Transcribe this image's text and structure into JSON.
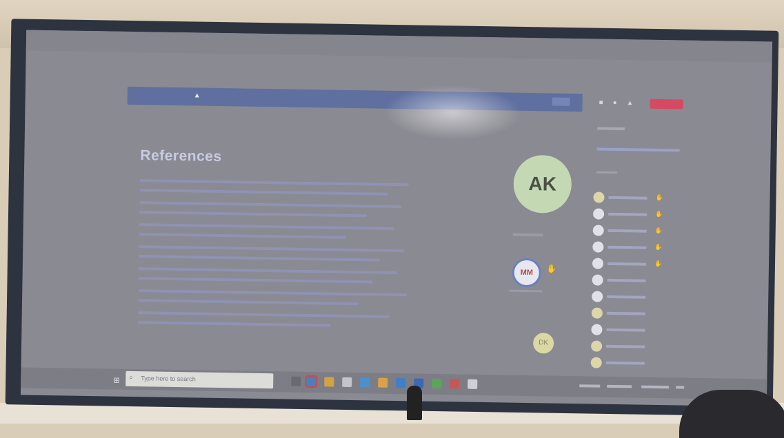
{
  "meeting": {
    "title_bar": "",
    "recording_banner": {
      "label": "",
      "message": "",
      "dismiss_label": ""
    }
  },
  "shared_content": {
    "heading": "References"
  },
  "stage": {
    "presenter_initials": "AK",
    "participant_initials_1": "MM",
    "participant_initials_2": "DK"
  },
  "participants_panel": {
    "heading": "",
    "rows": 11,
    "raised_hands_count": 5
  },
  "taskbar": {
    "search_placeholder": "Type here to search",
    "clock": ""
  },
  "colors": {
    "banner": "#5f6f9f",
    "leave_button": "#d54a62",
    "presenter_avatar": "#c5d8b4",
    "screen_background": "#8a8a92"
  }
}
